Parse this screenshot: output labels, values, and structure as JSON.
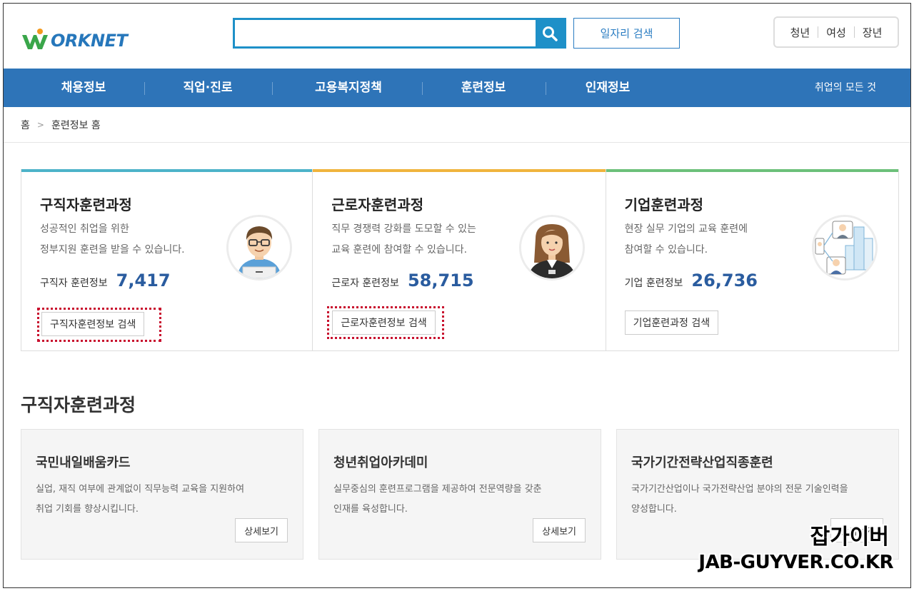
{
  "header": {
    "logo_text": "ORKNET",
    "search": {
      "value": "",
      "placeholder": ""
    },
    "job_search_label": "일자리 검색",
    "quick_links": [
      "청년",
      "여성",
      "장년"
    ]
  },
  "nav": {
    "items": [
      "채용정보",
      "직업·진로",
      "고용복지정책",
      "훈련정보",
      "인재정보"
    ],
    "right_label": "취업의 모든 것"
  },
  "breadcrumb": {
    "home": "홈",
    "current": "훈련정보 홈"
  },
  "cards": [
    {
      "title": "구직자훈련과정",
      "desc1": "성공적인 취업을 위한",
      "desc2": "정부지원 훈련을 받을 수 있습니다.",
      "count_label": "구직자 훈련정보",
      "count": "7,417",
      "button": "구직자훈련정보 검색",
      "bar_color": "#4db3c9"
    },
    {
      "title": "근로자훈련과정",
      "desc1": "직무 경쟁력 강화를 도모할 수 있는",
      "desc2": "교육 훈련에 참여할 수 있습니다.",
      "count_label": "근로자 훈련정보",
      "count": "58,715",
      "button": "근로자훈련정보 검색",
      "bar_color": "#f0b43c"
    },
    {
      "title": "기업훈련과정",
      "desc1": "현장 실무 기업의 교육 훈련에",
      "desc2": "참여할 수 있습니다.",
      "count_label": "기업 훈련정보",
      "count": "26,736",
      "button": "기업훈련과정 검색",
      "bar_color": "#6cc07a"
    }
  ],
  "section": {
    "title": "구직자훈련과정",
    "programs": [
      {
        "title": "국민내일배움카드",
        "desc1": "실업, 재직 여부에 관계없이 직무능력 교육을 지원하여",
        "desc2": "취업 기회를 향상시킵니다.",
        "button": "상세보기"
      },
      {
        "title": "청년취업아카데미",
        "desc1": "실무중심의 훈련프로그램을 제공하여 전문역량을 갖춘",
        "desc2": "인재를 육성합니다.",
        "button": "상세보기"
      },
      {
        "title": "국가기간전략산업직종훈련",
        "desc1": "국가기간산업이나 국가전략산업 분야의 전문 기술인력을",
        "desc2": "양성합니다.",
        "button": "상세보기"
      }
    ]
  },
  "watermark": {
    "line1": "잡가이버",
    "line2": "JAB-GUYVER.CO.KR"
  },
  "colors": {
    "nav_bg": "#2e74b8",
    "accent": "#1e90c8",
    "count": "#2a5c9f",
    "highlight": "#c8102e"
  }
}
